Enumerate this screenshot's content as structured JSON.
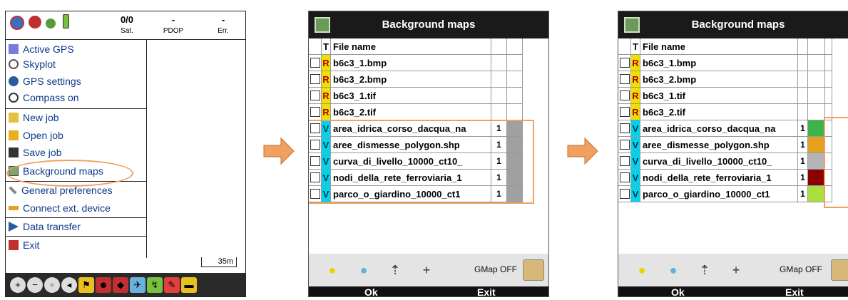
{
  "panel1": {
    "status": {
      "sat_count": "0/0",
      "sat_label": "Sat.",
      "pdop_value": "-",
      "pdop_label": "PDOP",
      "err_value": "-",
      "err_label": "Err."
    },
    "menu": [
      {
        "label": "Active GPS",
        "icon": "satellite-icon"
      },
      {
        "label": "Skyplot",
        "icon": "skyplot-icon"
      },
      {
        "label": "GPS settings",
        "icon": "globe-icon"
      },
      {
        "label": "Compass on",
        "icon": "compass-icon"
      },
      {
        "label": "New job",
        "icon": "folder-icon"
      },
      {
        "label": "Open job",
        "icon": "open-folder-icon"
      },
      {
        "label": "Save job",
        "icon": "floppy-icon"
      },
      {
        "label": "Background maps",
        "icon": "map-icon"
      },
      {
        "label": "General preferences",
        "icon": "wrench-icon"
      },
      {
        "label": "Connect ext. device",
        "icon": "plug-icon"
      },
      {
        "label": "Data transfer",
        "icon": "transfer-icon"
      },
      {
        "label": "Exit",
        "icon": "exit-icon"
      }
    ],
    "scale_label": "35m"
  },
  "dialog": {
    "title": "Background maps",
    "col_type": "T",
    "col_name": "File name",
    "ok": "Ok",
    "exit": "Exit",
    "gmap": "GMap OFF"
  },
  "panel2": {
    "rows": [
      {
        "type": "R",
        "name": "b6c3_1.bmp",
        "num": ""
      },
      {
        "type": "R",
        "name": "b6c3_2.bmp",
        "num": ""
      },
      {
        "type": "R",
        "name": "b6c3_1.tif",
        "num": ""
      },
      {
        "type": "R",
        "name": "b6c3_2.tif",
        "num": ""
      },
      {
        "type": "V",
        "name": "area_idrica_corso_dacqua_na",
        "num": "1"
      },
      {
        "type": "V",
        "name": "aree_dismesse_polygon.shp",
        "num": "1"
      },
      {
        "type": "V",
        "name": "curva_di_livello_10000_ct10_",
        "num": "1"
      },
      {
        "type": "V",
        "name": "nodi_della_rete_ferroviaria_1",
        "num": "1"
      },
      {
        "type": "V",
        "name": "parco_o_giardino_10000_ct1",
        "num": "1"
      }
    ]
  },
  "panel3": {
    "rows": [
      {
        "type": "R",
        "name": "b6c3_1.bmp",
        "num": "",
        "color": ""
      },
      {
        "type": "R",
        "name": "b6c3_2.bmp",
        "num": "",
        "color": ""
      },
      {
        "type": "R",
        "name": "b6c3_1.tif",
        "num": "",
        "color": ""
      },
      {
        "type": "R",
        "name": "b6c3_2.tif",
        "num": "",
        "color": ""
      },
      {
        "type": "V",
        "name": "area_idrica_corso_dacqua_na",
        "num": "1",
        "color": "#3cb44b"
      },
      {
        "type": "V",
        "name": "aree_dismesse_polygon.shp",
        "num": "1",
        "color": "#e6a020"
      },
      {
        "type": "V",
        "name": "curva_di_livello_10000_ct10_",
        "num": "1",
        "color": "#b4b4b4"
      },
      {
        "type": "V",
        "name": "nodi_della_rete_ferroviaria_1",
        "num": "1",
        "color": "#8b0000"
      },
      {
        "type": "V",
        "name": "parco_o_giardino_10000_ct1",
        "num": "1",
        "color": "#a8e040"
      }
    ]
  },
  "colors": {
    "highlight_orange": "#f0a060",
    "raster_badge": "#f0e000",
    "vector_badge": "#00d4e8",
    "menu_text": "#0a3a8a"
  }
}
